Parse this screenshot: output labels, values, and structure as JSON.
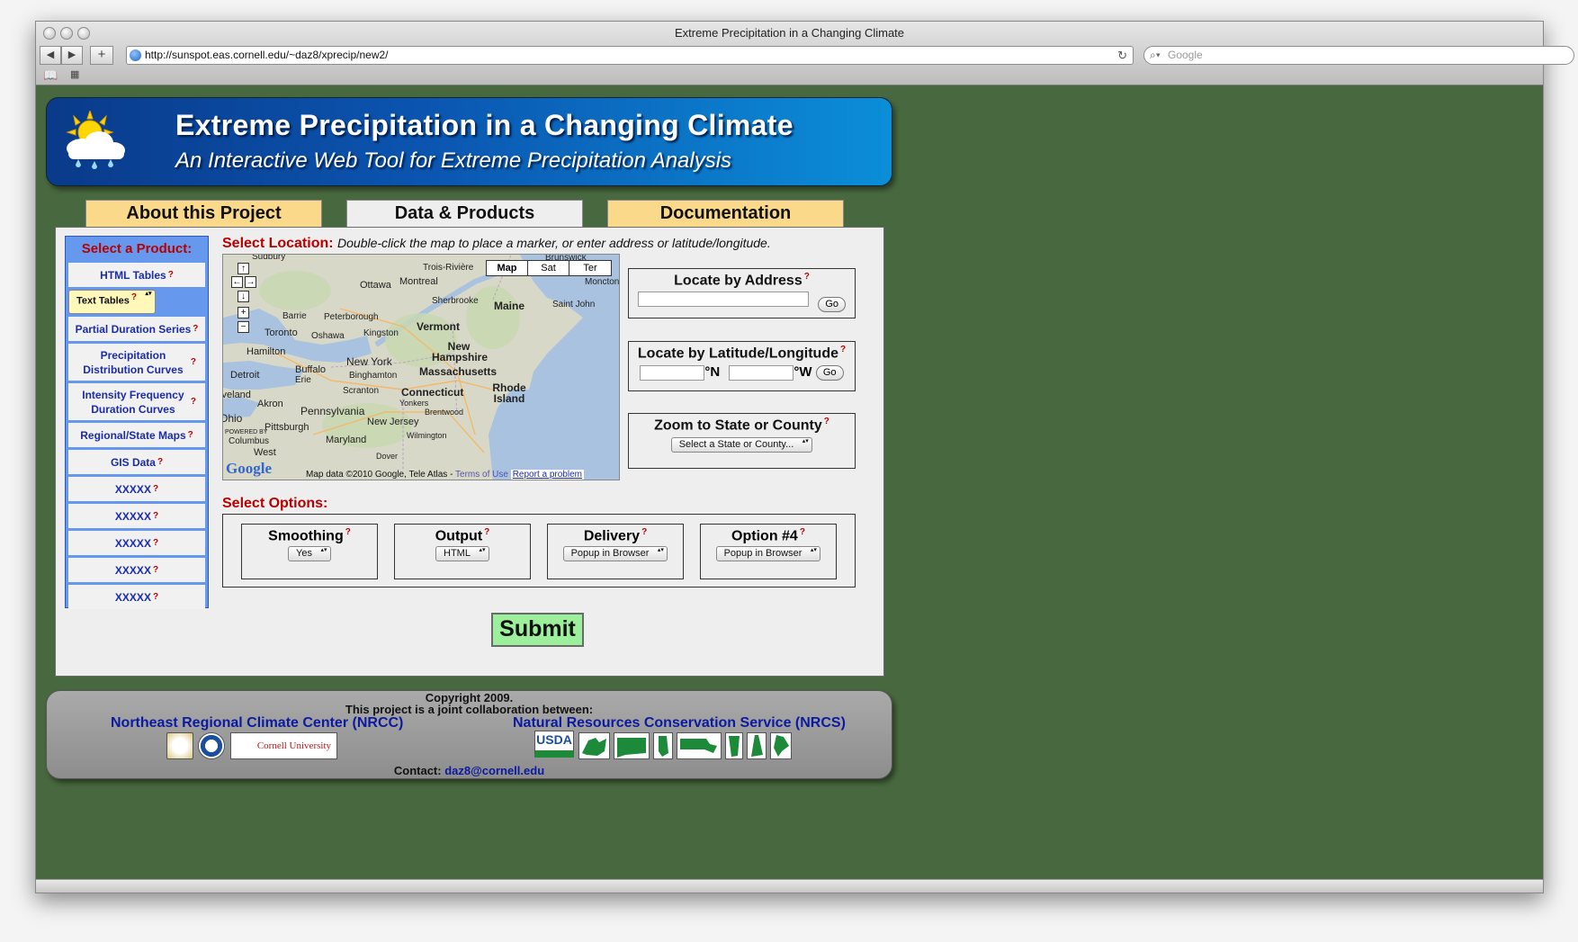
{
  "browser": {
    "window_title": "Extreme Precipitation in a Changing Climate",
    "url": "http://sunspot.eas.cornell.edu/~daz8/xprecip/new2/",
    "search_placeholder": "Google"
  },
  "header": {
    "title": "Extreme Precipitation in a Changing Climate",
    "subtitle": "An Interactive Web Tool for Extreme Precipitation Analysis"
  },
  "tabs": [
    {
      "label": "About this Project"
    },
    {
      "label": "Data & Products"
    },
    {
      "label": "Documentation"
    }
  ],
  "products": {
    "heading": "Select a Product:",
    "help_mark": "?",
    "items": [
      {
        "label": "HTML Tables"
      },
      {
        "label": "Text Tables",
        "selected": true
      },
      {
        "label": "Partial Duration Series"
      },
      {
        "label": "Precipitation Distribution Curves"
      },
      {
        "label": "Intensity Frequency Duration Curves"
      },
      {
        "label": "Regional/State Maps"
      },
      {
        "label": "GIS Data"
      },
      {
        "label": "XXXXX"
      },
      {
        "label": "XXXXX"
      },
      {
        "label": "XXXXX"
      },
      {
        "label": "XXXXX"
      },
      {
        "label": "XXXXX"
      }
    ]
  },
  "location": {
    "label": "Select Location:",
    "instructions": "Double-click the map to place a marker, or enter address or latitude/longitude."
  },
  "map": {
    "tabs": [
      "Map",
      "Sat",
      "Ter"
    ],
    "places": [
      "Sudbury",
      "Trois-Rivière",
      "Brunswick",
      "Ottawa",
      "Montreal",
      "Moncton",
      "Barrie",
      "Peterborough",
      "Sherbrooke",
      "Maine",
      "Saint John",
      "Toronto",
      "Oshawa",
      "Kingston",
      "Vermont",
      "Hamilton",
      "New Hampshire",
      "New York",
      "Buffalo",
      "Detroit",
      "Erie",
      "Binghamton",
      "Massachusetts",
      "Cleveland",
      "Scranton",
      "Connecticut",
      "Rhode Island",
      "Akron",
      "Yonkers",
      "Brentwood",
      "Pennsylvania",
      "Ohio",
      "Pittsburgh",
      "New Jersey",
      "Columbus",
      "Wilmington",
      "Maryland",
      "West",
      "Dover"
    ],
    "powered_by": "POWERED BY",
    "logo_text": "Google",
    "credit": "Map data ©2010 Google, Tele Atlas -",
    "terms": "Terms of Use",
    "report": "Report a problem"
  },
  "locate_address": {
    "title": "Locate by Address",
    "go": "Go"
  },
  "locate_latlon": {
    "title": "Locate by Latitude/Longitude",
    "north_unit": "°N",
    "west_unit": "°W",
    "go": "Go"
  },
  "zoom_state": {
    "title": "Zoom to State or County",
    "select_value": "Select a State or County..."
  },
  "options": {
    "label": "Select Options:",
    "items": [
      {
        "title": "Smoothing",
        "value": "Yes"
      },
      {
        "title": "Output",
        "value": "HTML"
      },
      {
        "title": "Delivery",
        "value": "Popup in Browser"
      },
      {
        "title": "Option #4",
        "value": "Popup in Browser"
      }
    ]
  },
  "submit_label": "Submit",
  "footer": {
    "copyright": "Copyright 2009.",
    "collab": "This project is a joint collaboration between:",
    "left_org": "Northeast Regional Climate Center (NRCC)",
    "right_org": "Natural Resources Conservation Service (NRCS)",
    "cornell": "Cornell University",
    "usda": "USDA",
    "contact_label": "Contact:",
    "contact_email": "daz8@cornell.edu"
  },
  "colors": {
    "page_bg": "#48693f",
    "header_blue": "#0b55b0",
    "tab_gold": "#fbd98a",
    "alert_red": "#b80000",
    "link_blue": "#0b1a9f",
    "submit_green": "#9cf09c"
  }
}
